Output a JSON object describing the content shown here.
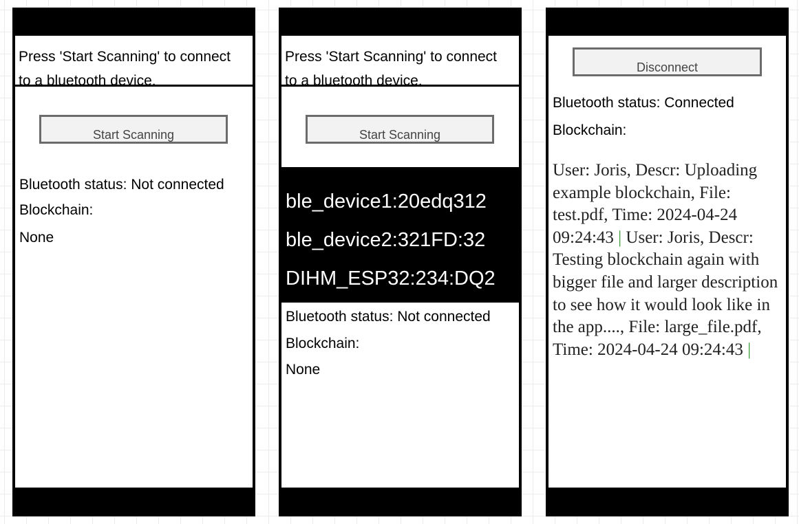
{
  "screen1": {
    "intro": "Press 'Start Scanning' to connect to a bluetooth device.",
    "intro_line1": "Press 'Start Scanning' to connect",
    "intro_line2": "to a bluetooth device.",
    "scan_button": "Start Scanning",
    "status": "Bluetooth status: Not connected",
    "blockchain_label": "Blockchain:",
    "blockchain_value": "None"
  },
  "screen2": {
    "intro_line1": "Press 'Start Scanning' to connect",
    "intro_line2": "to a bluetooth device.",
    "scan_button": "Start Scanning",
    "devices": [
      "ble_device1:20edq312",
      "ble_device2:321FD:32",
      "DIHM_ESP32:234:DQ2"
    ],
    "status": "Bluetooth status: Not connected",
    "blockchain_label": "Blockchain:",
    "blockchain_value": "None"
  },
  "screen3": {
    "disconnect_button": "Disconnect",
    "status": "Bluetooth status: Connected",
    "blockchain_label": "Blockchain:",
    "entries": [
      "User: Joris, Descr: Uploading example blockchain, File: test.pdf, Time: 2024-04-24 09:24:43",
      "User: Joris, Descr: Testing blockchain again with bigger file and larger description to see how it would look like in the app...., File: large_file.pdf, Time: 2024-04-24 09:24:43"
    ],
    "separator": "|"
  }
}
